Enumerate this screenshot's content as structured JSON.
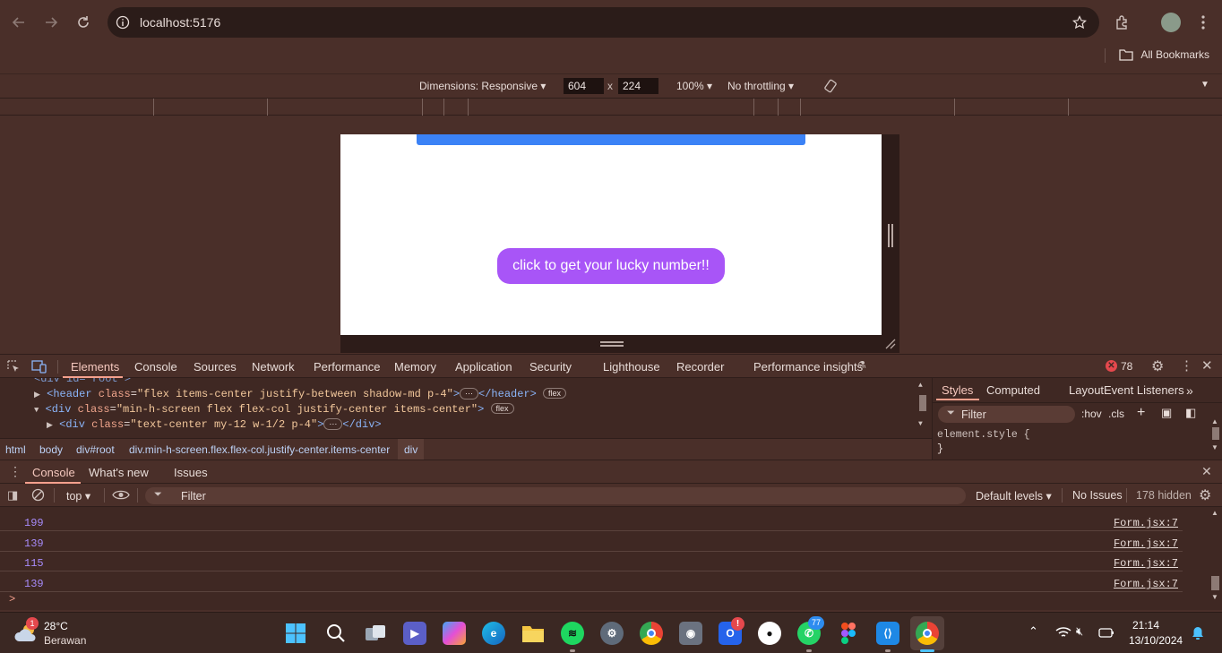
{
  "browser": {
    "url": "localhost:5176",
    "bookmarks_label": "All Bookmarks"
  },
  "device_toolbar": {
    "dimensions_label": "Dimensions: Responsive",
    "width": "604",
    "times": "x",
    "height": "224",
    "zoom": "100%",
    "throttling": "No throttling"
  },
  "page": {
    "button_label": "click to get your lucky number!!"
  },
  "devtools": {
    "tabs": [
      "Elements",
      "Console",
      "Sources",
      "Network",
      "Performance",
      "Memory",
      "Application",
      "Security",
      "Lighthouse",
      "Recorder",
      "Performance insights"
    ],
    "error_count": "78",
    "dom": {
      "line0": "<div id=\"root\">",
      "line1": {
        "open": "<header",
        "attr1": "class",
        "val1": "\"flex items-center justify-between shadow-md p-4\"",
        "close": "</header>",
        "badge": "flex"
      },
      "line2": {
        "open": "<div",
        "attr1": "class",
        "val1": "\"min-h-screen flex flex-col justify-center items-center\"",
        "close": ">",
        "badge": "flex"
      },
      "line3": {
        "open": "<div",
        "attr1": "class",
        "val1": "\"text-center my-12 w-1/2 p-4\"",
        "close": "</div>"
      }
    },
    "breadcrumbs": [
      "html",
      "body",
      "div#root",
      "div.min-h-screen.flex.flex-col.justify-center.items-center",
      "div"
    ],
    "styles": {
      "tabs": [
        "Styles",
        "Computed",
        "Layout",
        "Event Listeners"
      ],
      "filter_placeholder": "Filter",
      "hov": ":hov",
      "cls": ".cls",
      "rule": "element.style {",
      "rule_close": "}"
    },
    "drawer": {
      "tabs": [
        "Console",
        "What's new",
        "Issues"
      ],
      "context": "top",
      "filter_placeholder": "Filter",
      "levels": "Default levels",
      "issues": "No Issues",
      "hidden": "178 hidden"
    },
    "console_logs": [
      {
        "value": "199",
        "source": "Form.jsx:7"
      },
      {
        "value": "139",
        "source": "Form.jsx:7"
      },
      {
        "value": "115",
        "source": "Form.jsx:7"
      },
      {
        "value": "139",
        "source": "Form.jsx:7"
      }
    ],
    "prompt": ">"
  },
  "taskbar": {
    "weather": {
      "temp": "28°C",
      "condition": "Berawan",
      "badge": "1"
    },
    "whatsapp_badge": "77",
    "time": "21:14",
    "date": "13/10/2024"
  },
  "colors": {
    "accent_button": "#a855f7",
    "blue_bar": "#3b82f6",
    "log_value": "#a78bfa"
  }
}
